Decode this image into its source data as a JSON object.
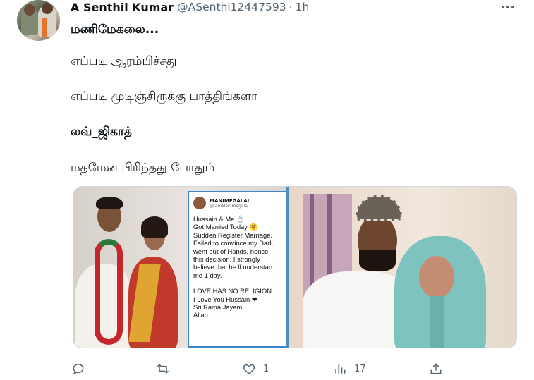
{
  "tweet": {
    "author_name": "A Senthil Kumar",
    "author_handle": "@ASenthi12447593",
    "separator": "·",
    "time": "1h",
    "lines": [
      "மணிமேகலை...",
      "எப்படி ஆரம்பிச்சது",
      "எப்படி முடிஞ்சிருக்கு பாத்திங்களா",
      "லவ்_ஜிகாத்",
      "மதமேன பிரிந்தது போதும்"
    ]
  },
  "media": {
    "post_name": "MANIMEGALAI",
    "post_handle": "@iamManimegalai",
    "post_lines": [
      "Hussain & Me 💍",
      "Got Married Today 🤗",
      "Sudden Register Marriage.",
      "Failed to convince my Dad,",
      "went out of Hands, hence",
      "this decision. I strongly",
      "believe that he ll understan",
      "me 1 day.",
      "",
      "LOVE HAS NO RELIGION",
      "I Love You Hussain ❤",
      "Sri Rama Jayam",
      "Allah"
    ]
  },
  "actions": {
    "reply_count": "",
    "retweet_count": "",
    "like_count": "1",
    "views_count": "17"
  },
  "icons": [
    "more-icon",
    "reply-icon",
    "retweet-icon",
    "like-icon",
    "views-icon",
    "share-icon"
  ]
}
